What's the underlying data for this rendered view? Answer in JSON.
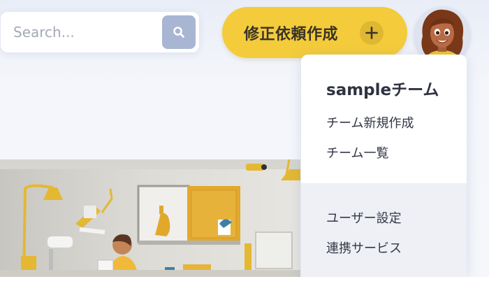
{
  "search": {
    "placeholder": "Search..."
  },
  "header": {
    "create_request_label": "修正依頼作成"
  },
  "account_menu": {
    "team_name": "sampleチーム",
    "team_items": [
      "チーム新規作成",
      "チーム一覧"
    ],
    "settings_items": [
      "ユーザー設定",
      "連携サービス"
    ]
  },
  "colors": {
    "accent_yellow": "#f3cb3b",
    "search_button": "#a8b6d3",
    "menu_lower_bg": "#eef0f6"
  },
  "icons": [
    "search-icon",
    "plus-icon",
    "avatar"
  ]
}
